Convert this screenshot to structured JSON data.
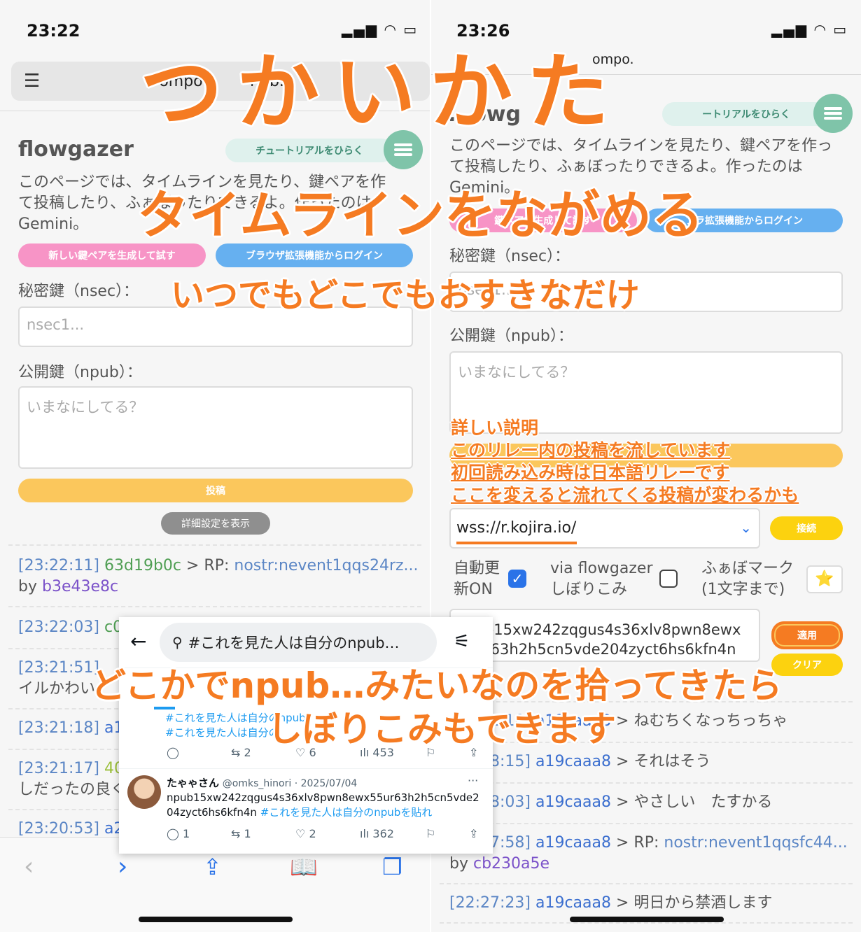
{
  "left": {
    "status_time": "23:22",
    "url_part1": "ompom",
    "url_part2": "hub.i",
    "app_title": "flowgazer",
    "tutorial_button": "チュートリアルをひらく",
    "desc_line1": "このページでは、タイムラインを見たり、鍵ペアを作",
    "desc_line2": "て投稿したり、ふぁぼったりできるよ。作ったのは",
    "desc_line3": "Gemini。",
    "gen_key_button": "新しい鍵ペアを生成して試す",
    "ext_login_button": "ブラウザ拡張機能からログイン",
    "nsec_label": "秘密鍵（nsec）：",
    "nsec_placeholder": "nsec1...",
    "npub_label": "公開鍵（npub）：",
    "post_placeholder": "いまなにしてる？",
    "post_button": "投稿",
    "details_button": "詳細設定を表示",
    "timeline": [
      {
        "time": "[23:22:11]",
        "user": "63d19b0c",
        "sep": " > RP: ",
        "text": "nostr:nevent1qqs24rz...",
        "by_label": "by ",
        "by_user": "b3e43e8c"
      },
      {
        "time": "[23:22:03]",
        "user": "c0",
        "sep": "",
        "text": ""
      },
      {
        "time": "[23:21:51]",
        "user": "",
        "sep": "",
        "text": "",
        "line2": "イルかわい"
      },
      {
        "time": "[23:21:18]",
        "user": "a19",
        "sep": "",
        "text": ""
      },
      {
        "time": "[23:21:17]",
        "user": "40",
        "sep": "",
        "text": "",
        "line2": "しだったの良く"
      },
      {
        "time": "[23:20:53]",
        "user": "a2",
        "sep": "",
        "text": ""
      }
    ]
  },
  "right": {
    "status_time": "23:26",
    "url_text": "ompo.",
    "app_title_partial": "...owg",
    "tutorial_button": "ートリアルをひらく",
    "desc_line1": "このページでは、タイムラインを見たり、鍵ペアを作っ",
    "desc_line2": "て投稿したり、ふぁぼったりできるよ。作ったのは",
    "desc_line3": "Gemini。",
    "gen_key_button": "鍵ペアを生成して試す",
    "ext_login_button": "ブラ拡張機能からログイン",
    "nsec_label": "秘密鍵（nsec）：",
    "nsec_placeholder": "nsec1...",
    "npub_label": "公開鍵（npub）：",
    "post_placeholder": "いまなにしてる？",
    "relay_value": "wss://r.kojira.io/",
    "connect_button": "接続",
    "auto_update_line1": "自動更",
    "auto_update_line2": "新ON",
    "via_line1": "via flowgazer",
    "via_line2": "しぼりこみ",
    "fav_line1": "ふぁぼマーク",
    "fav_line2": "(1文字まで)",
    "fav_mark": "⭐",
    "filter_line1": "npub15xw242zqgus4s36xlv8pwn8ewx",
    "filter_line2": "55ur63h2h5cn5vde204zyct6hs6kfn4n",
    "apply_button": "適用",
    "clear_button": "クリア",
    "timeline": [
      {
        "time": "[22:32:10]",
        "user": "a19caaa8",
        "sep": " > ",
        "text": "ねむちくなっちっちゃ"
      },
      {
        "time": "[22:28:15]",
        "user": "a19caaa8",
        "sep": " > ",
        "text": "それはそう"
      },
      {
        "time": "[22:28:03]",
        "user": "a19caaa8",
        "sep": " > ",
        "text": "やさしい　たすかる"
      },
      {
        "time": "[22:27:58]",
        "user": "a19caaa8",
        "sep": " > RP: ",
        "text": "nostr:nevent1qqsfc44...",
        "by_label": "by ",
        "by_user": "cb230a5e"
      },
      {
        "time": "[22:27:23]",
        "user": "a19caaa8",
        "sep": " > ",
        "text": "明日から禁酒します"
      }
    ]
  },
  "x_panel": {
    "search_text": "#これを見た人は自分のnpub…",
    "tweet1_tags1": "#これを見た人は自分のnpub",
    "tweet1_tags2": "#これを見た人は自分の",
    "tweet1_replies": "",
    "tweet1_retweets": "2",
    "tweet1_likes": "6",
    "tweet1_views": "453",
    "tweet2_name": "たゃゃさん",
    "tweet2_handle": "@omks_hinori · 2025/07/04",
    "tweet2_line1": "npub15xw242zqgus4s36xlv8pwn8ewx55ur63h2h5cn5vde2",
    "tweet2_line2": "04zyct6hs6kfn4n",
    "tweet2_tag": "#これを見た人は自分のnpubを貼れ",
    "tweet2_replies": "1",
    "tweet2_retweets": "1",
    "tweet2_likes": "2",
    "tweet2_views": "362"
  },
  "overlay": {
    "title": "つかいかた",
    "subtitle": "タイムラインをながめる",
    "tagline": "いつでもどこでもおすきなだけ",
    "note_line1": "詳しい説明",
    "note_line2": "このリレー内の投稿を流しています",
    "note_line3": "初回読み込み時は日本語リレーです",
    "note_line4": "ここを変えると流れてくる投稿が変わるかも",
    "bottom_line1": "どこかでnpub…みたいなのを拾ってきたら",
    "bottom_line2": "しぼりこみもできます"
  },
  "colors": {
    "accent_orange": "#f57b22",
    "pink_button": "#f794c6",
    "blue_button": "#66b0f0",
    "post_button": "#fbc75c",
    "connect_button": "#fcd20f",
    "menu_button": "#7fc4a9"
  }
}
